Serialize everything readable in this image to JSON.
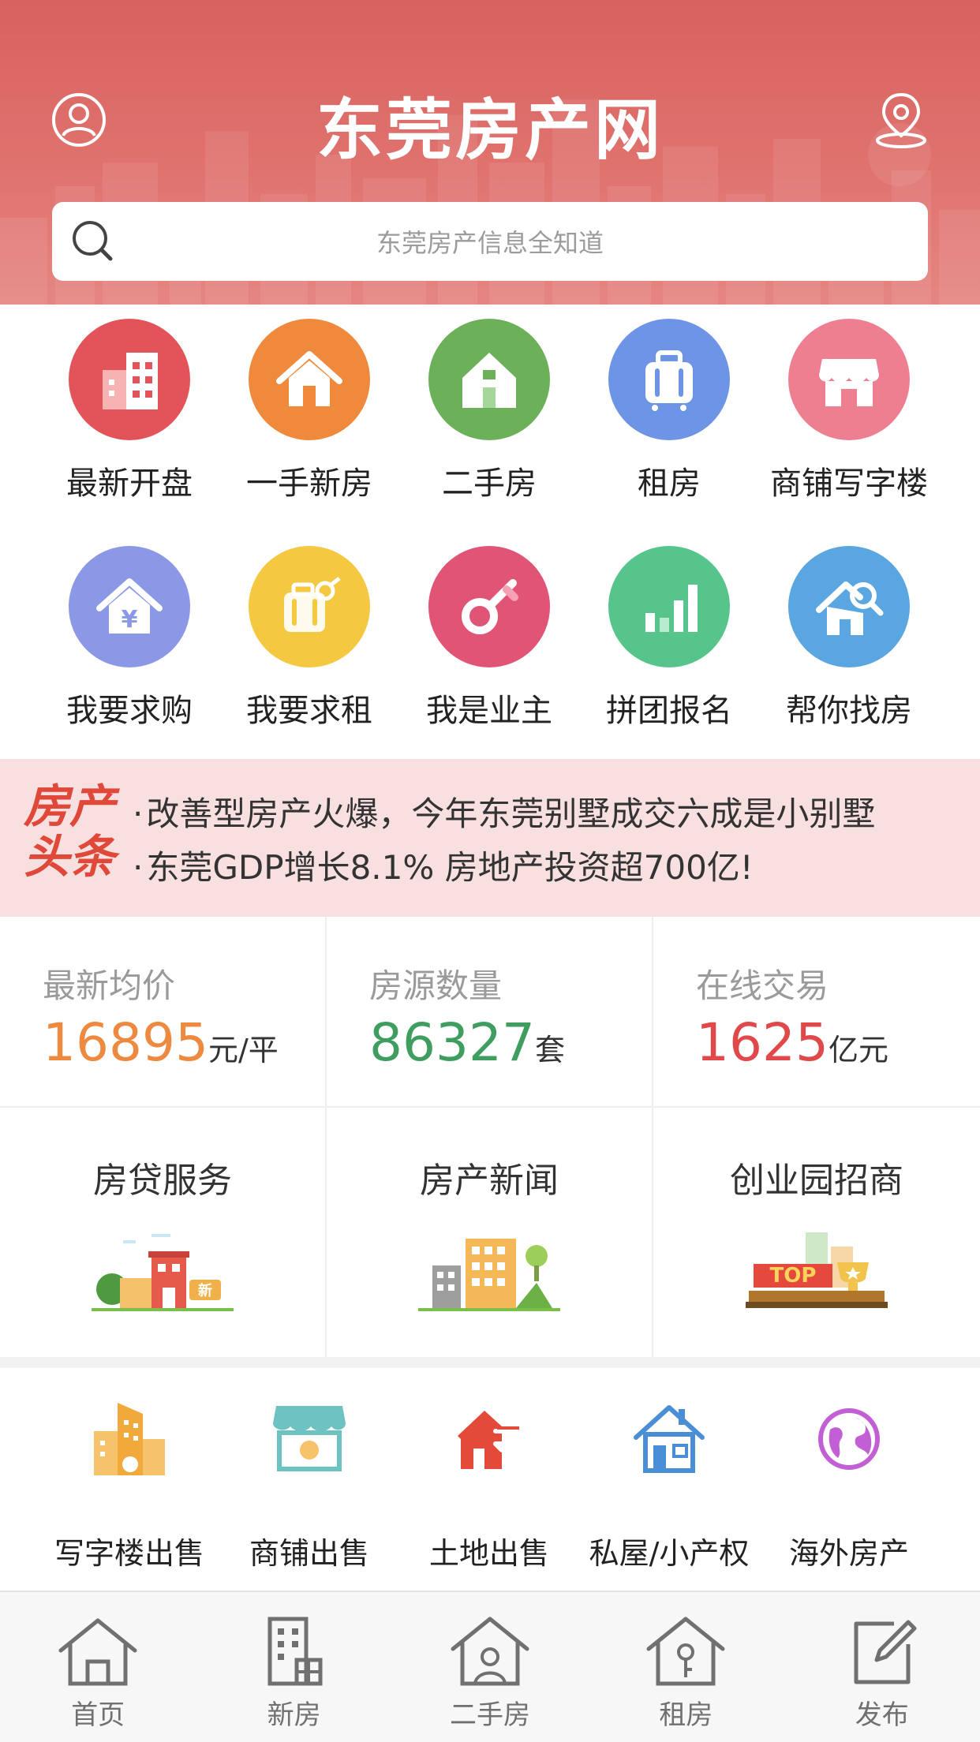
{
  "header": {
    "title": "东莞房产网",
    "search_placeholder": "东莞房产信息全知道",
    "brand_color": "#d7625f"
  },
  "categories_row1": [
    {
      "label": "最新开盘",
      "icon": "buildings-icon",
      "color": "#e2535a"
    },
    {
      "label": "一手新房",
      "icon": "house-icon",
      "color": "#ef8a3c"
    },
    {
      "label": "二手房",
      "icon": "house-green-icon",
      "color": "#6cb05a"
    },
    {
      "label": "租房",
      "icon": "suitcase-icon",
      "color": "#6e94e6"
    },
    {
      "label": "商铺写字楼",
      "icon": "shop-icon",
      "color": "#ee7f90"
    }
  ],
  "categories_row2": [
    {
      "label": "我要求购",
      "icon": "house-yen-icon",
      "color": "#8a98e6"
    },
    {
      "label": "我要求租",
      "icon": "luggage-key-icon",
      "color": "#f4c841"
    },
    {
      "label": "我是业主",
      "icon": "key-icon",
      "color": "#e05476"
    },
    {
      "label": "拼团报名",
      "icon": "bar-chart-icon",
      "color": "#57c48c"
    },
    {
      "label": "帮你找房",
      "icon": "house-search-icon",
      "color": "#5aa6e0"
    }
  ],
  "news": {
    "logo_line1": "房产",
    "logo_line2": "头条",
    "items": [
      "改善型房产火爆，今年东莞别墅成交六成是小别墅",
      "东莞GDP增长8.1% 房地产投资超700亿!"
    ]
  },
  "stats": [
    {
      "label": "最新均价",
      "value": "16895",
      "unit": "元/平",
      "color": "#ee8a3f"
    },
    {
      "label": "房源数量",
      "value": "86327",
      "unit": "套",
      "color": "#3f9e5f"
    },
    {
      "label": "在线交易",
      "value": "1625",
      "unit": "亿元",
      "color": "#e0484a"
    }
  ],
  "services": [
    {
      "title": "房贷服务",
      "art": "new-house-illustration",
      "badge": "新"
    },
    {
      "title": "房产新闻",
      "art": "building-illustration"
    },
    {
      "title": "创业园招商",
      "art": "top-trophy-illustration",
      "badge": "TOP"
    }
  ],
  "quick_links": [
    {
      "label": "写字楼出售",
      "icon": "office-building-icon",
      "color": "#f2a93b"
    },
    {
      "label": "商铺出售",
      "icon": "storefront-icon",
      "color": "#6cc3c1"
    },
    {
      "label": "土地出售",
      "icon": "land-transfer-icon",
      "color": "#e34a3a"
    },
    {
      "label": "私屋/小产权",
      "icon": "small-house-icon",
      "color": "#4a8fd6"
    },
    {
      "label": "海外房产",
      "icon": "globe-icon",
      "color": "#c25fd4"
    }
  ],
  "tabbar": [
    {
      "label": "首页",
      "icon": "home-icon"
    },
    {
      "label": "新房",
      "icon": "new-house-icon"
    },
    {
      "label": "二手房",
      "icon": "second-hand-house-icon"
    },
    {
      "label": "租房",
      "icon": "rent-house-icon"
    },
    {
      "label": "发布",
      "icon": "edit-icon"
    }
  ]
}
